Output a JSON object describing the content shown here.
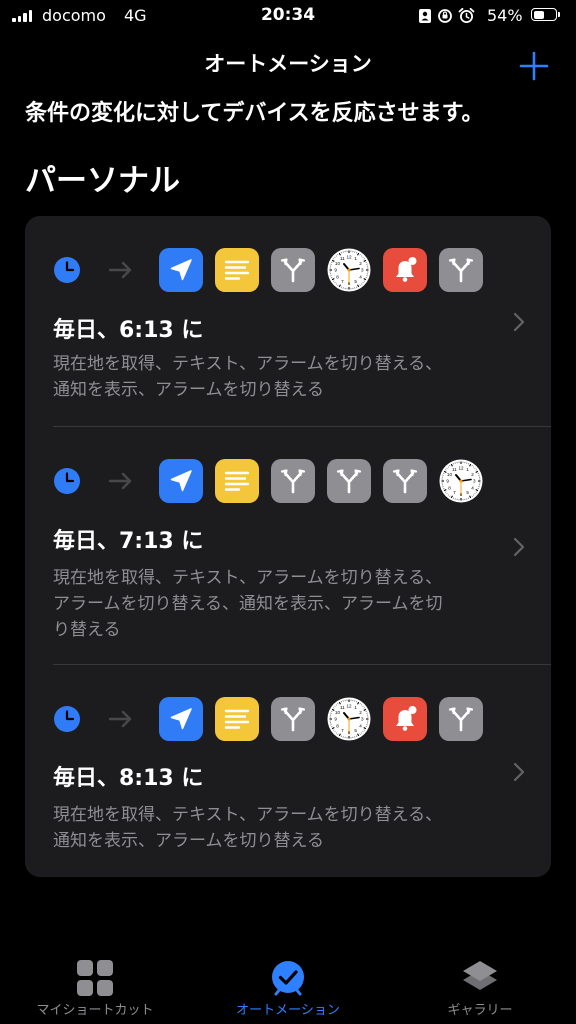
{
  "status_bar": {
    "carrier": "docomo",
    "network": "4G",
    "time": "20:34",
    "battery_percent": "54%",
    "battery_level": 0.54
  },
  "nav": {
    "title": "オートメーション",
    "add_icon": "plus-icon"
  },
  "subtitle": "条件の変化に対してデバイスを反応させます。",
  "section_title": "パーソナル",
  "colors": {
    "accent": "#2f80ff",
    "location": "#2f7cf6",
    "text_action": "#f4c73a",
    "scripting": "#8e8e93",
    "notification": "#e74c3c",
    "card_bg": "#1c1c1e",
    "secondary_text": "#8e8e93"
  },
  "automations": [
    {
      "trigger_icon": "clock-icon",
      "actions": [
        "location-icon",
        "text-icon",
        "branch-icon",
        "alarm-clock-icon",
        "notification-bell-icon",
        "branch-icon"
      ],
      "time": "毎日、6:13 に",
      "description": [
        "現在地を取得、テキスト、アラームを切り替える、",
        "通知を表示、アラームを切り替える"
      ]
    },
    {
      "trigger_icon": "clock-icon",
      "actions": [
        "location-icon",
        "text-icon",
        "branch-icon",
        "branch-icon",
        "branch-icon",
        "alarm-clock-icon"
      ],
      "time": "毎日、7:13 に",
      "description": [
        "現在地を取得、テキスト、アラームを切り替える、",
        "アラームを切り替える、通知を表示、アラームを切",
        "り替える"
      ]
    },
    {
      "trigger_icon": "clock-icon",
      "actions": [
        "location-icon",
        "text-icon",
        "branch-icon",
        "alarm-clock-icon",
        "notification-bell-icon",
        "branch-icon"
      ],
      "time": "毎日、8:13 に",
      "description": [
        "現在地を取得、テキスト、アラームを切り替える、",
        "通知を表示、アラームを切り替える"
      ]
    }
  ],
  "tabs": [
    {
      "label": "マイショートカット",
      "icon": "grid-icon",
      "active": false
    },
    {
      "label": "オートメーション",
      "icon": "automation-check-icon",
      "active": true
    },
    {
      "label": "ギャラリー",
      "icon": "gallery-layers-icon",
      "active": false
    }
  ]
}
